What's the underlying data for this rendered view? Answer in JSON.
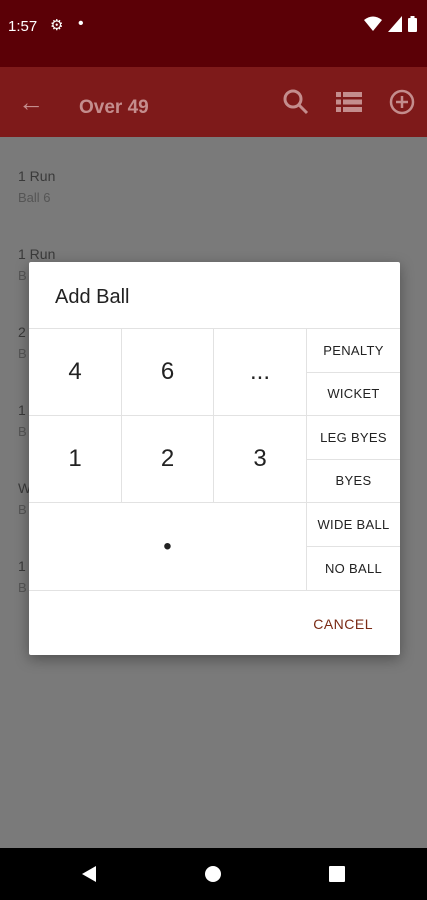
{
  "status": {
    "time": "1:57",
    "dot": "•"
  },
  "appbar": {
    "title": "Over 49"
  },
  "list": [
    {
      "title": "1 Run",
      "subtitle": "Ball 6"
    },
    {
      "title": "1 Run",
      "subtitle": "B"
    },
    {
      "title": "2",
      "subtitle": "B"
    },
    {
      "title": "1",
      "subtitle": "B"
    },
    {
      "title": "W",
      "subtitle": "B"
    },
    {
      "title": "1",
      "subtitle": "B"
    }
  ],
  "dialog": {
    "title": "Add Ball",
    "keys": [
      "4",
      "6",
      "...",
      "1",
      "2",
      "3",
      "•"
    ],
    "side_buttons": [
      "PENALTY",
      "WICKET",
      "LEG BYES",
      "BYES",
      "WIDE BALL",
      "NO BALL"
    ],
    "cancel": "CANCEL"
  },
  "colors": {
    "statusbar": "#5b0006",
    "appbar": "#7e1a1a",
    "scrim": "#7a7a7a",
    "accent": "#7a2a14"
  }
}
